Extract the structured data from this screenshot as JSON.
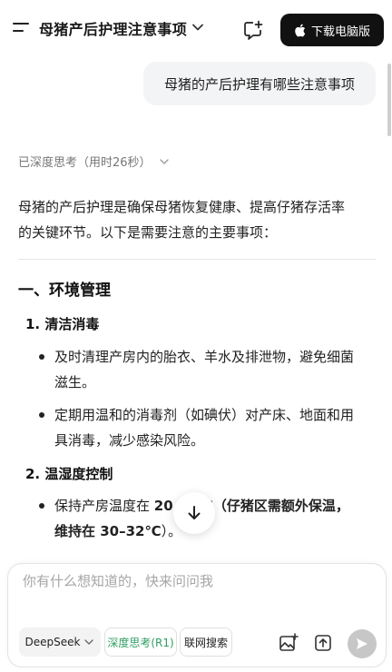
{
  "header": {
    "title": "母猪产后护理注意事项",
    "download_label": "下载电脑版"
  },
  "user_message": "母猪的产后护理有哪些注意事项",
  "thinking_label": "已深度思考（用时26秒）",
  "answer": {
    "intro_line1": "母猪的产后护理是确保母猪恢复健康、提高仔猪存活率",
    "intro_line2": "的关键环节。以下是需要注意的主要事项：",
    "section1_title": "一、环境管理",
    "item1_title": "1. 清洁消毒",
    "item1_b1_l1": "及时清理产房内的胎衣、羊水及排泄物，避免细菌",
    "item1_b1_l2": "滋生。",
    "item1_b2_l1": "定期用温和的消毒剂（如碘伏）对产床、地面和用",
    "item1_b2_l2": "具消毒，减少感染风险。",
    "item2_title": "2. 温湿度控制",
    "item2_b1_l1a": "保持产房温度在 ",
    "item2_b1_l1b": "20",
    "item2_b1_l1c": "℃（仔猪区需额外保温，",
    "item2_b1_l2a": "维持在 30–32℃",
    "item2_b1_l2b": "）。"
  },
  "input": {
    "placeholder": "你有什么想知道的，快来问问我",
    "model_label": "DeepSeek",
    "deep_think_label": "深度思考(R1)",
    "web_search_label": "联网搜索"
  },
  "colors": {
    "accent_green": "#2f9e63",
    "dark_button": "#111111",
    "bubble_bg": "#f3f4f6"
  }
}
